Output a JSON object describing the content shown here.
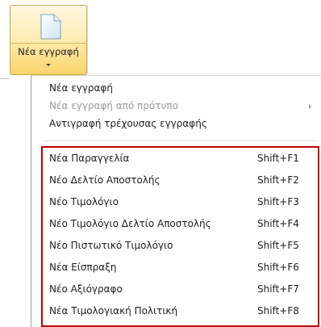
{
  "ribbon_button": {
    "label": "Νέα εγγραφή",
    "icon": "new-document-icon"
  },
  "menu": {
    "items": [
      {
        "label": "Νέα εγγραφή",
        "enabled": true
      },
      {
        "label": "Νέα εγγραφή από πρότυπο",
        "enabled": false,
        "has_submenu": true
      },
      {
        "label": "Αντιγραφή τρέχουσας εγγραφής",
        "enabled": true
      }
    ],
    "document_items": [
      {
        "label": "Νέα Παραγγελία",
        "shortcut": "Shift+F1"
      },
      {
        "label": "Νέο Δελτίο Αποστολής",
        "shortcut": "Shift+F2"
      },
      {
        "label": "Νέο Τιμολόγιο",
        "shortcut": "Shift+F3"
      },
      {
        "label": "Νέο Τιμολόγιο Δελτίο Αποστολής",
        "shortcut": "Shift+F4"
      },
      {
        "label": "Νέο Πιστωτικό Τιμολόγιο",
        "shortcut": "Shift+F5"
      },
      {
        "label": "Νέα Είσπραξη",
        "shortcut": "Shift+F6"
      },
      {
        "label": "Νέο Αξιόγραφο",
        "shortcut": "Shift+F7"
      },
      {
        "label": "Νέα Τιμολογιακή Πολιτική",
        "shortcut": "Shift+F8"
      }
    ]
  },
  "colors": {
    "button_border": "#c9a64a",
    "button_fill": "#fde9a8",
    "highlight_border": "#c00000",
    "disabled_text": "#9a9a9a"
  }
}
